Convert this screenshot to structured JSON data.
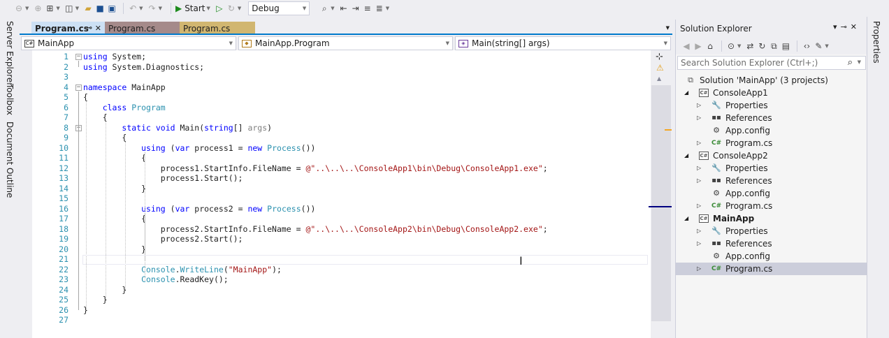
{
  "toolbar": {
    "start_label": "Start",
    "config_value": "Debug"
  },
  "left_tabs": [
    "Server Explorer",
    "Toolbox",
    "Document Outline"
  ],
  "doc_tabs": [
    {
      "label": "Program.cs",
      "active": true,
      "color": "#cce0f4"
    },
    {
      "label": "Program.cs",
      "active": false,
      "color": "#a58a8a"
    },
    {
      "label": "Program.cs",
      "active": false,
      "color": "#d1b670"
    }
  ],
  "nav": {
    "project": "MainApp",
    "type": "MainApp.Program",
    "member": "Main(string[] args)"
  },
  "editor": {
    "lines": [
      {
        "n": "1",
        "tokens": [
          {
            "t": "using",
            "c": "kw"
          },
          {
            "t": " System;"
          }
        ]
      },
      {
        "n": "2",
        "tokens": [
          {
            "t": "using",
            "c": "kw"
          },
          {
            "t": " System.Diagnostics;"
          }
        ]
      },
      {
        "n": "3",
        "tokens": []
      },
      {
        "n": "4",
        "tokens": [
          {
            "t": "namespace",
            "c": "kw"
          },
          {
            "t": " MainApp"
          }
        ]
      },
      {
        "n": "5",
        "tokens": [
          {
            "t": "{"
          }
        ]
      },
      {
        "n": "6",
        "tokens": [
          {
            "t": "    "
          },
          {
            "t": "class",
            "c": "kw"
          },
          {
            "t": " "
          },
          {
            "t": "Program",
            "c": "ty"
          }
        ]
      },
      {
        "n": "7",
        "tokens": [
          {
            "t": "    {"
          }
        ]
      },
      {
        "n": "8",
        "tokens": [
          {
            "t": "        "
          },
          {
            "t": "static",
            "c": "kw"
          },
          {
            "t": " "
          },
          {
            "t": "void",
            "c": "kw"
          },
          {
            "t": " Main("
          },
          {
            "t": "string",
            "c": "kw"
          },
          {
            "t": "[] "
          },
          {
            "t": "args",
            "c": "pm"
          },
          {
            "t": ")"
          }
        ]
      },
      {
        "n": "9",
        "tokens": [
          {
            "t": "        {"
          }
        ]
      },
      {
        "n": "10",
        "tokens": [
          {
            "t": "            "
          },
          {
            "t": "using",
            "c": "kw"
          },
          {
            "t": " ("
          },
          {
            "t": "var",
            "c": "kw"
          },
          {
            "t": " process1 = "
          },
          {
            "t": "new",
            "c": "kw"
          },
          {
            "t": " "
          },
          {
            "t": "Process",
            "c": "ty"
          },
          {
            "t": "())"
          }
        ]
      },
      {
        "n": "11",
        "tokens": [
          {
            "t": "            {"
          }
        ]
      },
      {
        "n": "12",
        "tokens": [
          {
            "t": "                process1.StartInfo.FileName = "
          },
          {
            "t": "@\"..\\..\\..\\ConsoleApp1\\bin\\Debug\\ConsoleApp1.exe\"",
            "c": "str"
          },
          {
            "t": ";"
          }
        ]
      },
      {
        "n": "13",
        "tokens": [
          {
            "t": "                process1.Start();"
          }
        ]
      },
      {
        "n": "14",
        "tokens": [
          {
            "t": "            }"
          }
        ]
      },
      {
        "n": "15",
        "tokens": []
      },
      {
        "n": "16",
        "tokens": [
          {
            "t": "            "
          },
          {
            "t": "using",
            "c": "kw"
          },
          {
            "t": " ("
          },
          {
            "t": "var",
            "c": "kw"
          },
          {
            "t": " process2 = "
          },
          {
            "t": "new",
            "c": "kw"
          },
          {
            "t": " "
          },
          {
            "t": "Process",
            "c": "ty"
          },
          {
            "t": "())"
          }
        ]
      },
      {
        "n": "17",
        "tokens": [
          {
            "t": "            {"
          }
        ]
      },
      {
        "n": "18",
        "tokens": [
          {
            "t": "                process2.StartInfo.FileName = "
          },
          {
            "t": "@\"..\\..\\..\\ConsoleApp2\\bin\\Debug\\ConsoleApp2.exe\"",
            "c": "str"
          },
          {
            "t": ";"
          }
        ]
      },
      {
        "n": "19",
        "tokens": [
          {
            "t": "                process2.Start();"
          }
        ]
      },
      {
        "n": "20",
        "tokens": [
          {
            "t": "            }"
          }
        ]
      },
      {
        "n": "21",
        "tokens": []
      },
      {
        "n": "22",
        "tokens": [
          {
            "t": "            "
          },
          {
            "t": "Console",
            "c": "ty"
          },
          {
            "t": "."
          },
          {
            "t": "WriteLine",
            "c": "ty"
          },
          {
            "t": "("
          },
          {
            "t": "\"MainApp\"",
            "c": "str"
          },
          {
            "t": ");"
          }
        ]
      },
      {
        "n": "23",
        "tokens": [
          {
            "t": "            "
          },
          {
            "t": "Console",
            "c": "ty"
          },
          {
            "t": ".ReadKey();"
          }
        ]
      },
      {
        "n": "24",
        "tokens": [
          {
            "t": "        }"
          }
        ]
      },
      {
        "n": "25",
        "tokens": [
          {
            "t": "    }"
          }
        ]
      },
      {
        "n": "26",
        "tokens": [
          {
            "t": "}"
          }
        ]
      },
      {
        "n": "27",
        "tokens": []
      }
    ]
  },
  "solution_explorer": {
    "title": "Solution Explorer",
    "search_placeholder": "Search Solution Explorer (Ctrl+;)",
    "nodes": [
      {
        "label": "Solution 'MainApp' (3 projects)",
        "icon": "solution-icon",
        "depth": 0,
        "expander": "",
        "bold": false,
        "selected": false
      },
      {
        "label": "ConsoleApp1",
        "icon": "csharp-project-icon",
        "depth": 1,
        "expander": "expanded",
        "bold": false,
        "selected": false
      },
      {
        "label": "Properties",
        "icon": "wrench-icon",
        "depth": 2,
        "expander": "collapsed",
        "bold": false,
        "selected": false
      },
      {
        "label": "References",
        "icon": "references-icon",
        "depth": 2,
        "expander": "collapsed",
        "bold": false,
        "selected": false
      },
      {
        "label": "App.config",
        "icon": "config-file-icon",
        "depth": 2,
        "expander": "",
        "bold": false,
        "selected": false
      },
      {
        "label": "Program.cs",
        "icon": "csharp-file-icon",
        "depth": 2,
        "expander": "collapsed",
        "bold": false,
        "selected": false
      },
      {
        "label": "ConsoleApp2",
        "icon": "csharp-project-icon",
        "depth": 1,
        "expander": "expanded",
        "bold": false,
        "selected": false
      },
      {
        "label": "Properties",
        "icon": "wrench-icon",
        "depth": 2,
        "expander": "collapsed",
        "bold": false,
        "selected": false
      },
      {
        "label": "References",
        "icon": "references-icon",
        "depth": 2,
        "expander": "collapsed",
        "bold": false,
        "selected": false
      },
      {
        "label": "App.config",
        "icon": "config-file-icon",
        "depth": 2,
        "expander": "",
        "bold": false,
        "selected": false
      },
      {
        "label": "Program.cs",
        "icon": "csharp-file-icon",
        "depth": 2,
        "expander": "collapsed",
        "bold": false,
        "selected": false
      },
      {
        "label": "MainApp",
        "icon": "csharp-project-icon",
        "depth": 1,
        "expander": "expanded",
        "bold": true,
        "selected": false
      },
      {
        "label": "Properties",
        "icon": "wrench-icon",
        "depth": 2,
        "expander": "collapsed",
        "bold": false,
        "selected": false
      },
      {
        "label": "References",
        "icon": "references-icon",
        "depth": 2,
        "expander": "collapsed",
        "bold": false,
        "selected": false
      },
      {
        "label": "App.config",
        "icon": "config-file-icon",
        "depth": 2,
        "expander": "",
        "bold": false,
        "selected": false
      },
      {
        "label": "Program.cs",
        "icon": "csharp-file-icon",
        "depth": 2,
        "expander": "collapsed",
        "bold": false,
        "selected": true
      }
    ]
  },
  "right_tabs": [
    "Properties"
  ]
}
